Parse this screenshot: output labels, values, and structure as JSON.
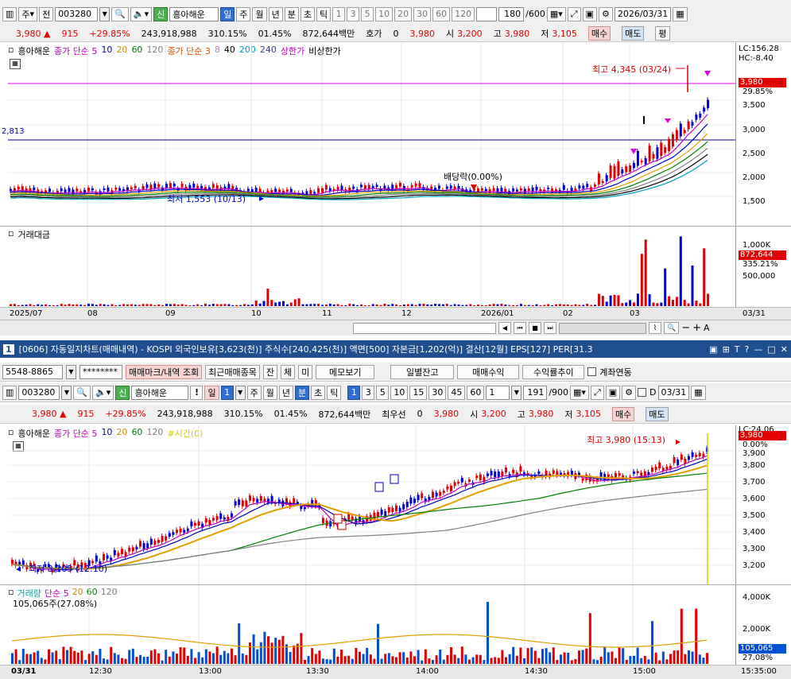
{
  "top": {
    "market": "주",
    "prev": "전",
    "code": "003280",
    "credit_badge": "신",
    "name": "흥아해운",
    "periods": [
      "일",
      "주",
      "월",
      "년",
      "분",
      "초",
      "틱"
    ],
    "active_period": "일",
    "intervals": [
      "1",
      "3",
      "5",
      "10",
      "20",
      "30",
      "60",
      "120"
    ],
    "count": "180",
    "count_max": "/600",
    "date": "2026/03/31",
    "quote": {
      "price": "3,980",
      "change": "915",
      "rate": "+29.85%",
      "volume": "243,918,988",
      "vol_ratio": "310.15%",
      "turnover": "01.45%",
      "amount": "872,644백만",
      "hoga_label": "호가",
      "hoga_value": "0",
      "ask": "3,980",
      "open_label": "시",
      "open": "3,200",
      "high_label": "고",
      "high": "3,980",
      "low_label": "저",
      "low": "3,105",
      "buy": "매수",
      "sell": "매도",
      "eval": "평"
    },
    "legend": {
      "name": "흥아해운",
      "ma5_label": "종가 단순 5",
      "ma_items": [
        "10",
        "20",
        "60",
        "120"
      ],
      "ma3_label": "종가 단순 3",
      "ma3_items": [
        "8",
        "40",
        "200",
        "240"
      ],
      "upper": "상한가",
      "lower": "비상한가"
    },
    "lc": "LC:156.28",
    "hc": "HC:-8.40",
    "price_tag": "3,980",
    "price_tag_rate": "29.85%",
    "hline_label": "2,813",
    "high_annotation": "최고 4,345 (03/24)",
    "low_annotation": "최저 1,553 (10/13)",
    "dividend_annotation": "배당락(0.00%)",
    "price_axis": [
      "3,500",
      "3,000",
      "2,500",
      "2,000",
      "1,500"
    ],
    "volume_legend": "거래대금",
    "volume_axis": [
      "1,000K",
      "500,000"
    ],
    "volume_tag": "872,644",
    "volume_tag_rate": "335.21%",
    "x_labels": [
      "2025/07",
      "08",
      "09",
      "10",
      "11",
      "12",
      "2026/01",
      "02",
      "03"
    ],
    "x_end": "03/31"
  },
  "window": {
    "number": "1",
    "title": "[0606] 자동일지차트(매매내역) - KOSPI 외국인보유[3,623(천)] 주식수[240,425(천)] 액면[500] 자본금[1,202(억)] 결산[12월] EPS[127] PER[31.3"
  },
  "bottom": {
    "account": "5548-8865",
    "password": "********",
    "buttons": [
      "매매마크/내역 조회",
      "최근매매종목",
      "잔",
      "체",
      "미",
      "메모보기",
      "일별잔고",
      "매매수익",
      "수익률추이"
    ],
    "checkbox_label": "계좌연동",
    "code": "003280",
    "credit_badge": "신",
    "name": "흥아해운",
    "day_label": "일",
    "day_value": "1",
    "periods": [
      "주",
      "월",
      "년",
      "분",
      "초",
      "틱"
    ],
    "active_period": "분",
    "intervals": [
      "1",
      "3",
      "5",
      "10",
      "15",
      "30",
      "45",
      "60"
    ],
    "unit_value": "1",
    "count": "191",
    "count_max": "/900",
    "d_label": "D",
    "date": "03/31",
    "quote": {
      "price": "3,980",
      "change": "915",
      "rate": "+29.85%",
      "volume": "243,918,988",
      "vol_ratio": "310.15%",
      "turnover": "01.45%",
      "amount": "872,644백만",
      "best_label": "최우선",
      "best_value": "0",
      "ask": "3,980",
      "open_label": "시",
      "open": "3,200",
      "high_label": "고",
      "high": "3,980",
      "low_label": "저",
      "low": "3,105",
      "buy": "매수",
      "sell": "매도"
    },
    "legend": {
      "name": "흥아해운",
      "ma_label": "종가 단순 5",
      "ma_items": [
        "10",
        "20",
        "60",
        "120"
      ],
      "time": "#시간(0)"
    },
    "lc": "LC:24.06",
    "price_tag": "3,980",
    "price_tag_rate": "0.00%",
    "high_annotation": "최고 3,980 (15:13)",
    "low_annotation": "최저 3,105 (12:10)",
    "price_axis": [
      "3,900",
      "3,800",
      "3,700",
      "3,600",
      "3,500",
      "3,400",
      "3,300",
      "3,200"
    ],
    "volume_legend": "거래량",
    "volume_ma": "단순 5",
    "volume_ma_items": [
      "20",
      "60",
      "120"
    ],
    "volume_value": "105,065주(27.08%)",
    "volume_axis": [
      "4,000K",
      "2,000K"
    ],
    "volume_tag": "105,065",
    "volume_tag_rate": "27.08%",
    "x_start": "03/31",
    "x_labels": [
      "12:30",
      "13:00",
      "13:30",
      "14:00",
      "14:30",
      "15:00"
    ],
    "x_end": "15:35:00"
  }
}
